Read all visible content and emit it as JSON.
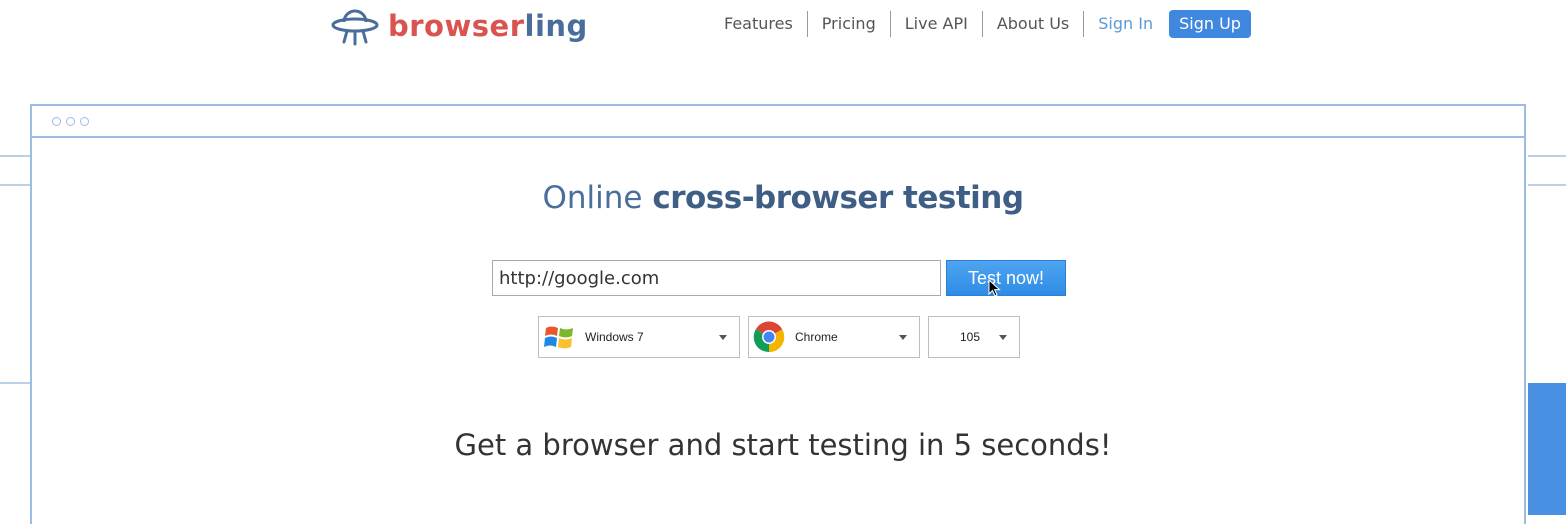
{
  "brand": {
    "name_part1": "browser",
    "name_part2": "ling",
    "color_primary": "#d9534f",
    "color_secondary": "#4a6e9c",
    "logo_icon": "ufo-icon"
  },
  "nav": {
    "items": [
      {
        "label": "Features"
      },
      {
        "label": "Pricing"
      },
      {
        "label": "Live API"
      },
      {
        "label": "About Us"
      }
    ],
    "sign_in": "Sign In",
    "sign_up": "Sign Up"
  },
  "hero": {
    "title_light": "Online",
    "title_bold": "cross-browser testing",
    "url_value": "http://google.com",
    "test_button": "Test now!",
    "os": {
      "value": "Windows 7",
      "icon": "windows-icon"
    },
    "browser": {
      "value": "Chrome",
      "icon": "chrome-icon"
    },
    "version": {
      "value": "105"
    },
    "tagline": "Get a browser and start testing in 5 seconds!"
  },
  "colors": {
    "accent": "#4a90e2",
    "frame": "#9dbde0",
    "button": "#3f87df"
  }
}
